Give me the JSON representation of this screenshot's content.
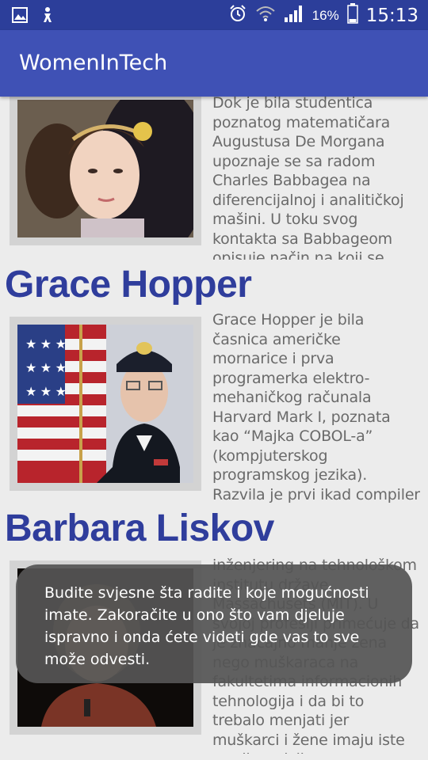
{
  "status_bar": {
    "battery_percent": "16%",
    "time": "15:13",
    "icons": [
      "image-icon",
      "accessibility-icon",
      "alarm-icon",
      "wifi-icon",
      "signal-icon",
      "battery-icon"
    ]
  },
  "app_bar": {
    "title": "WomenInTech"
  },
  "cards": [
    {
      "name": "",
      "text": "Dok je bila studentica poznatog matematičara Augustusa De Morgana upoznaje se sa radom Charles Babbagea na diferencijalnoj i analitičkoj mašini. U toku svog kontakta sa Babbageom opisuje način na koji se"
    },
    {
      "name": "Grace Hopper",
      "text": "Grace Hopper je bila časnica američke mornarice i prva programerka elektro-mehaničkog računala Harvard Mark I, poznata kao “Majka COBOL-a” (kompjuterskog programskog jezika). Razvila je prvi ikad compiler (pretvara kod u programski"
    },
    {
      "name": "Barbara Liskov",
      "text": "inženjering na tehnološkom institutu države Massachusets (MIT). U svojoj profesiji primećuje da je značajno manje žena nego muškaraca na fakultetima informacionih tehnologija i da bi to trebalo menjati jer muškarci i žene imaju iste predispozicije."
    }
  ],
  "toast": {
    "message": "Budite svjesne šta radite i koje mogućnosti imate. Zakoračite u ono što vam djeluje ispravno i onda ćete videti gde vas to sve može odvesti."
  },
  "colors": {
    "status_bar": "#2c3e9a",
    "app_bar": "#3f51b5",
    "name_text": "#2f3d9c",
    "body_text": "#6a6a6a",
    "background": "#ececec"
  }
}
